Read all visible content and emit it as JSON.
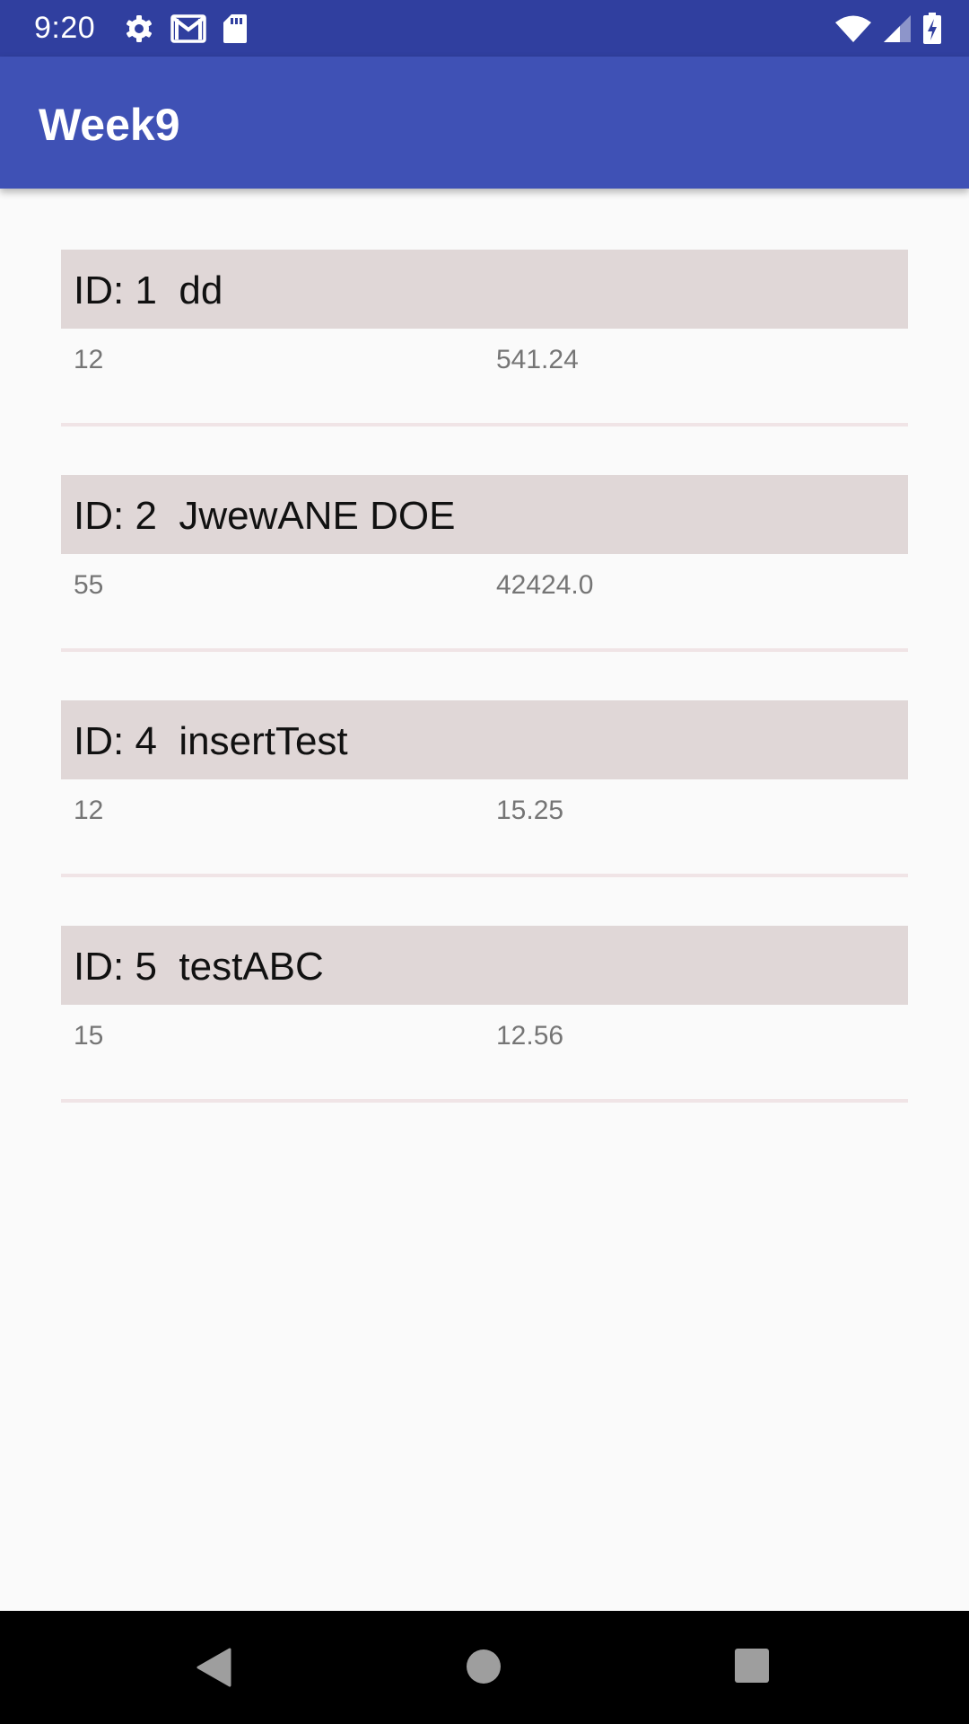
{
  "status_bar": {
    "time": "9:20",
    "icons": [
      "settings-icon",
      "gmail-icon",
      "sd-card-icon",
      "wifi-icon",
      "cell-signal-icon",
      "battery-charging-icon"
    ]
  },
  "app_bar": {
    "title": "Week9"
  },
  "items": [
    {
      "title": "ID: 1  dd",
      "quantity": "12",
      "price": "541.24"
    },
    {
      "title": "ID: 2  JwewANE DOE",
      "quantity": "55",
      "price": "42424.0"
    },
    {
      "title": "ID: 4  insertTest",
      "quantity": "12",
      "price": "15.25"
    },
    {
      "title": "ID: 5  testABC",
      "quantity": "15",
      "price": "12.56"
    }
  ],
  "nav_bar": {
    "buttons": [
      "back-icon",
      "home-icon",
      "recents-icon"
    ]
  },
  "colors": {
    "status_bar": "#303f9f",
    "app_bar": "#3f51b5",
    "item_header": "#e0d7d7",
    "divider": "#f0e4e6",
    "background": "#fafafa"
  }
}
